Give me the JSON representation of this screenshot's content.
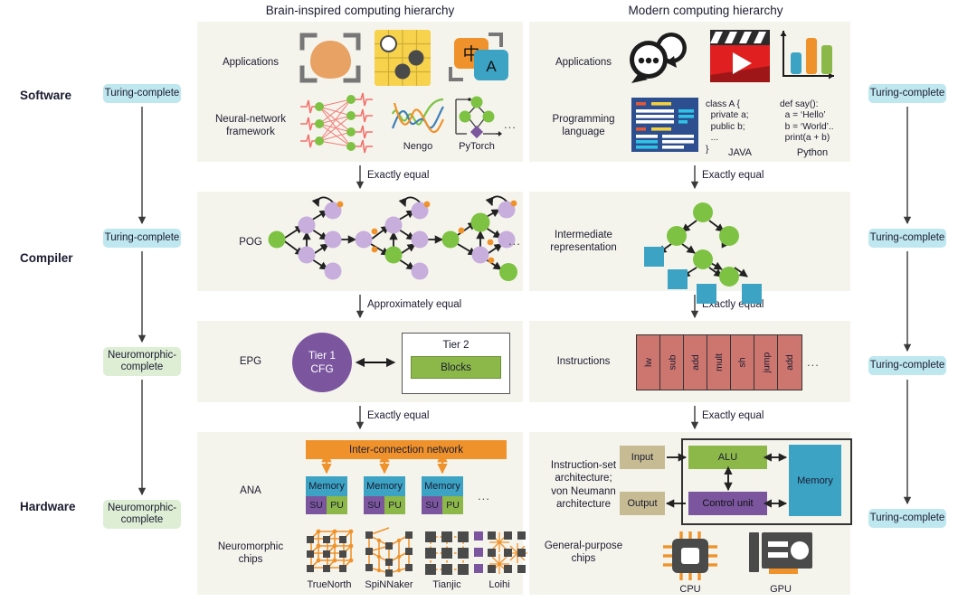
{
  "columns": {
    "left_title": "Brain-inspired computing hierarchy",
    "right_title": "Modern computing hierarchy"
  },
  "stages": [
    {
      "label": "Software"
    },
    {
      "label": "Compiler"
    },
    {
      "label": "Hardware"
    }
  ],
  "left_badges": [
    {
      "label": "Turing-complete",
      "kind": "turing",
      "color": "#bfe7f0"
    },
    {
      "label": "Turing-complete",
      "kind": "turing",
      "color": "#bfe7f0"
    },
    {
      "label": "Neuromorphic-\ncomplete",
      "kind": "neuro",
      "color": "#ddeed5"
    },
    {
      "label": "Neuromorphic-\ncomplete",
      "kind": "neuro",
      "color": "#ddeed5"
    }
  ],
  "right_badges": [
    {
      "label": "Turing-complete",
      "kind": "turing",
      "color": "#bfe7f0"
    },
    {
      "label": "Turing-complete",
      "kind": "turing",
      "color": "#bfe7f0"
    },
    {
      "label": "Turing-complete",
      "kind": "turing",
      "color": "#bfe7f0"
    },
    {
      "label": "Turing-complete",
      "kind": "turing",
      "color": "#bfe7f0"
    }
  ],
  "left_rows": {
    "applications": "Applications",
    "nn_framework": "Neural-network\nframework",
    "pog": "POG",
    "epg": "EPG",
    "ana": "ANA",
    "neuro_chips": "Neuromorphic\nchips"
  },
  "right_rows": {
    "applications": "Applications",
    "prog_language": "Programming\nlanguage",
    "intermediate": "Intermediate\nrepresentation",
    "instructions": "Instructions",
    "isa": "Instruction-set\narchitecture;\nvon Neumann\narchitecture",
    "gp_chips": "General-purpose\nchips"
  },
  "equalities": {
    "left": [
      "Exactly equal",
      "Approximately equal",
      "Exactly equal"
    ],
    "right": [
      "Exactly equal",
      "Exactly equal",
      "Exactly equal"
    ]
  },
  "framework_names": [
    "Nengo",
    "PyTorch"
  ],
  "framework_ellipsis": "...",
  "app_icons": {
    "go_board_label": "go-board-icon",
    "translate_cn": "中",
    "translate_en": "A"
  },
  "code_samples": [
    {
      "name": "JAVA",
      "lines": [
        "class A {",
        "  private a;",
        "  public b;",
        "  ...",
        "}"
      ]
    },
    {
      "name": "Python",
      "lines": [
        "def say():",
        "  a = ‘Hello’",
        "  b = ‘World’..",
        "  print(a + b)"
      ]
    }
  ],
  "epg": {
    "tier1_line1": "Tier 1",
    "tier1_line2": "CFG",
    "tier2_title": "Tier 2",
    "blocks_label": "Blocks",
    "tier1_color": "#7b569f",
    "blocks_color": "#8cb84a"
  },
  "instructions": {
    "cells": [
      "lw",
      "sub",
      "add",
      "mult",
      "sh",
      "jump",
      "add"
    ],
    "ellipsis": "...",
    "color": "#cd7670"
  },
  "ana": {
    "network_label": "Inter-connection network",
    "network_color": "#f0922b",
    "units": [
      {
        "memory": "Memory",
        "su": "SU",
        "pu": "PU"
      },
      {
        "memory": "Memory",
        "su": "SU",
        "pu": "PU"
      },
      {
        "memory": "Memory",
        "su": "SU",
        "pu": "PU"
      }
    ],
    "ellipsis": "...",
    "memory_color": "#3ca3c4",
    "su_color": "#7b569f",
    "pu_color": "#8cb84a"
  },
  "neuro_chip_names": [
    "TrueNorth",
    "SpiNNaker",
    "Tianjic",
    "Loihi"
  ],
  "von_neumann": {
    "input": "Input",
    "output": "Output",
    "alu": "ALU",
    "control_unit": "Control unit",
    "memory": "Memory",
    "io_color": "#c6bb92",
    "alu_color": "#8cb84a",
    "cu_color": "#7b569f",
    "mem_color": "#3ca3c4"
  },
  "gp_chip_names": [
    "CPU",
    "GPU"
  ],
  "palette": {
    "panel_bg": "#f5f4ec",
    "green_node": "#7dc242",
    "purple_node": "#c7aedc",
    "orange": "#f0922b",
    "blue": "#3ca3c4",
    "red_pink": "#f2706d",
    "dark_gray": "#4a4a4a"
  }
}
